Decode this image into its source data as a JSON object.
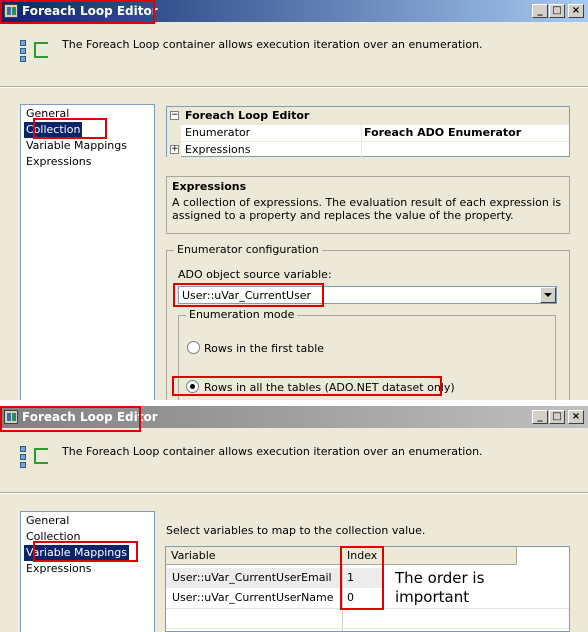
{
  "top": {
    "title": "Foreach Loop Editor",
    "header_text": "The Foreach Loop container allows execution iteration over an enumeration.",
    "nav": [
      "General",
      "Collection",
      "Variable Mappings",
      "Expressions"
    ],
    "grid": {
      "category": "Foreach Loop Editor",
      "rows": [
        {
          "name": "Enumerator",
          "value": "Foreach ADO Enumerator",
          "expander": ""
        },
        {
          "name": "Expressions",
          "value": "",
          "expander": "+"
        }
      ]
    },
    "description": {
      "title": "Expressions",
      "body": "A collection of expressions. The evaluation result of each expression is assigned to a property and replaces the value of the property."
    },
    "enumerator_config": {
      "label": "Enumerator configuration",
      "source_label": "ADO object source variable:",
      "source_value": "User::uVar_CurrentUser",
      "mode_label": "Enumeration mode",
      "option_first": "Rows in the first table",
      "option_all": "Rows in all the tables (ADO.NET dataset only)",
      "selected": "all"
    }
  },
  "bottom": {
    "title": "Foreach Loop Editor",
    "header_text": "The Foreach Loop container allows execution iteration over an enumeration.",
    "nav": [
      "General",
      "Collection",
      "Variable Mappings",
      "Expressions"
    ],
    "prompt": "Select variables to map to the collection value.",
    "columns": [
      "Variable",
      "Index"
    ],
    "rows": [
      {
        "variable": "User::uVar_CurrentUserEmail",
        "index": "1"
      },
      {
        "variable": "User::uVar_CurrentUserName",
        "index": "0"
      }
    ],
    "note_line1": "The order is",
    "note_line2": "important"
  },
  "window_buttons": {
    "minimize": "_",
    "maximize": "□",
    "close": "×"
  },
  "colors": {
    "highlight": "#e00000",
    "selection": "#0a246a",
    "titlebar": "#0a246a"
  }
}
